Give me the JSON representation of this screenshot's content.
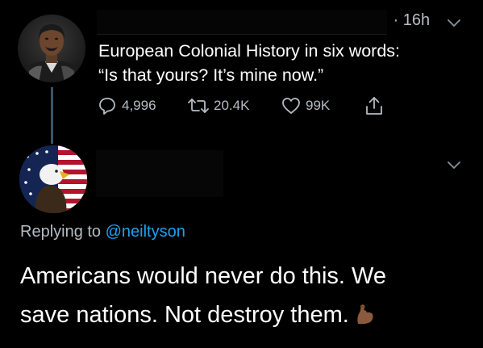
{
  "colors": {
    "background": "#000000",
    "text_primary": "#ffffff",
    "text_secondary": "#b6bcc3",
    "accent": "#1da1f2",
    "thread_line": "#3d5466"
  },
  "original_tweet": {
    "timestamp": "16h",
    "text_lines": [
      "European Colonial History in six words:",
      "“Is that yours? It’s mine now.”"
    ],
    "actions": {
      "replies": "4,996",
      "retweets": "20.4K",
      "likes": "99K"
    },
    "icons": {
      "reply": "reply-icon",
      "retweet": "retweet-icon",
      "like": "heart-icon",
      "share": "share-icon",
      "menu": "chevron-down-icon"
    }
  },
  "reply_tweet": {
    "replying_prefix": "Replying to",
    "replying_mention": "@neiltyson",
    "text_lines": [
      "Americans would never do this. We",
      "save nations. Not destroy them."
    ],
    "emoji": "flexed-biceps-emoji",
    "icons": {
      "menu": "chevron-down-icon"
    }
  }
}
